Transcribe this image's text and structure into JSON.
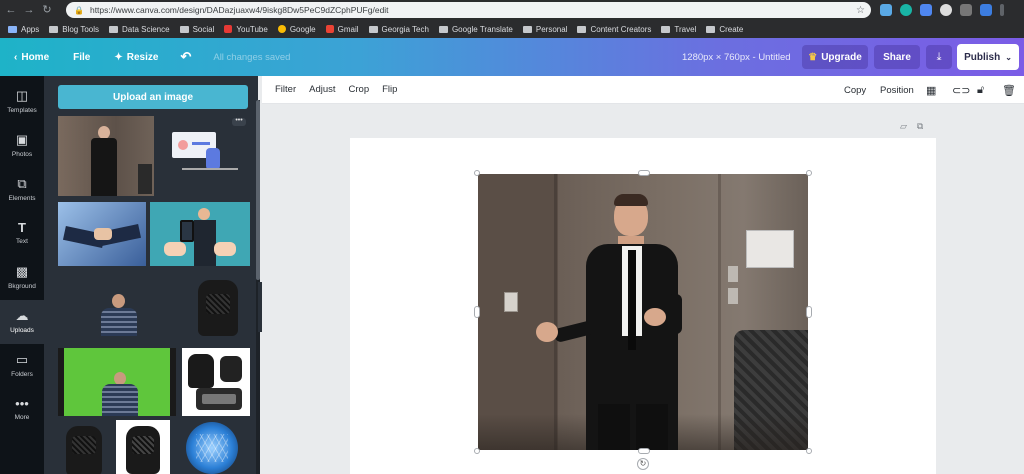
{
  "browser": {
    "url": "https://www.canva.com/design/DADazjuaxw4/9iskg8Dw5PeC9dZCphPUFg/edit",
    "bookmarks": [
      "Apps",
      "Blog Tools",
      "Data Science",
      "Social",
      "YouTube",
      "Google",
      "Gmail",
      "Georgia Tech",
      "Google Translate",
      "Personal",
      "Content Creators",
      "Travel",
      "Create"
    ]
  },
  "header": {
    "home": "Home",
    "file": "File",
    "resize": "Resize",
    "saved_status": "All changes saved",
    "dimensions": "1280px × 760px - Untitled",
    "upgrade": "Upgrade",
    "share": "Share",
    "publish": "Publish"
  },
  "rail": {
    "items": [
      {
        "label": "Templates",
        "icon": "templates-icon"
      },
      {
        "label": "Photos",
        "icon": "photos-icon"
      },
      {
        "label": "Elements",
        "icon": "elements-icon"
      },
      {
        "label": "Text",
        "icon": "text-icon"
      },
      {
        "label": "Bkground",
        "icon": "background-icon"
      },
      {
        "label": "Uploads",
        "icon": "uploads-icon"
      },
      {
        "label": "Folders",
        "icon": "folders-icon"
      },
      {
        "label": "More",
        "icon": "more-icon"
      }
    ]
  },
  "panel": {
    "upload_button": "Upload an image"
  },
  "toolbar": {
    "filter": "Filter",
    "adjust": "Adjust",
    "crop": "Crop",
    "flip": "Flip",
    "copy": "Copy",
    "position": "Position"
  }
}
